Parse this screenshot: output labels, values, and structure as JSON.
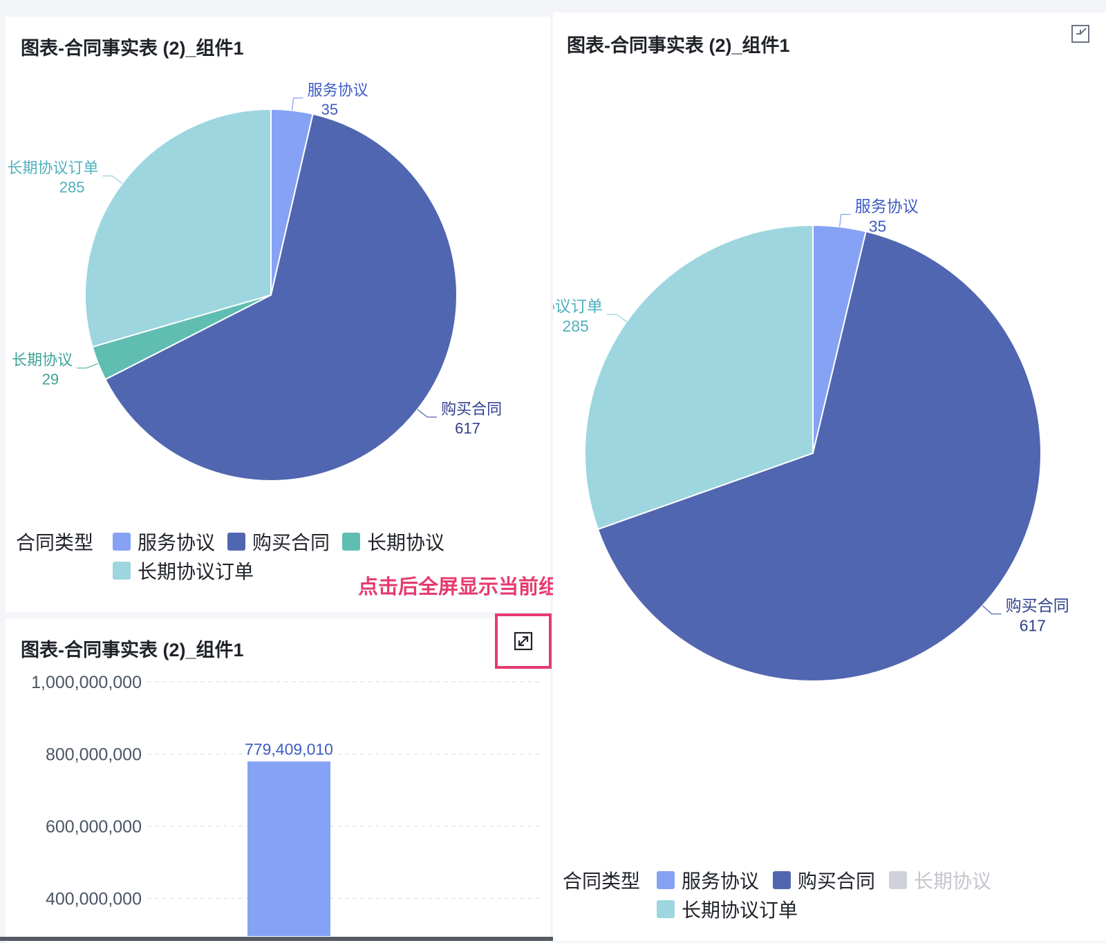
{
  "colors": {
    "service": "#86a2f5",
    "purchase": "#5166b0",
    "longterm": "#5fbeb1",
    "longterm_order": "#9dd6df",
    "disabled": "#cfd2d8",
    "accent": "#e63a6f"
  },
  "panels": {
    "pie_small": {
      "title": "图表-合同事实表 (2)_组件1"
    },
    "bar": {
      "title": "图表-合同事实表 (2)_组件1"
    },
    "pie_full": {
      "title": "图表-合同事实表 (2)_组件1"
    }
  },
  "legend": {
    "title": "合同类型",
    "items": [
      "服务协议",
      "购买合同",
      "长期协议",
      "长期协议订单"
    ]
  },
  "icons": {
    "expand": "expand-fullscreen-icon",
    "collapse": "collapse-fullscreen-icon"
  },
  "annotation": {
    "text": "点击后全屏显示当前组件"
  },
  "chart_data": [
    {
      "type": "pie",
      "title": "图表-合同事实表 (2)_组件1",
      "legend_title": "合同类型",
      "categories": [
        "服务协议",
        "购买合同",
        "长期协议",
        "长期协议订单"
      ],
      "values": [
        35,
        617,
        29,
        285
      ],
      "colors": [
        "#86a2f5",
        "#5166b0",
        "#5fbeb1",
        "#9dd6df"
      ],
      "legend_position": "bottom"
    },
    {
      "type": "bar",
      "title": "图表-合同事实表 (2)_组件1",
      "y_ticks": [
        "1,000,000,000",
        "800,000,000",
        "600,000,000",
        "400,000,000"
      ],
      "ylim": [
        0,
        1000000000
      ],
      "series": [
        {
          "values": [
            779409010
          ],
          "value_label": "779,409,010"
        }
      ],
      "grid": true
    },
    {
      "type": "pie",
      "title": "图表-合同事实表 (2)_组件1",
      "legend_title": "合同类型",
      "categories": [
        "服务协议",
        "购买合同",
        "长期协议",
        "长期协议订单"
      ],
      "values": [
        35,
        617,
        29,
        285
      ],
      "hidden_categories": [
        "长期协议"
      ],
      "colors": [
        "#86a2f5",
        "#5166b0",
        "#5fbeb1",
        "#9dd6df"
      ],
      "legend_position": "bottom"
    }
  ]
}
